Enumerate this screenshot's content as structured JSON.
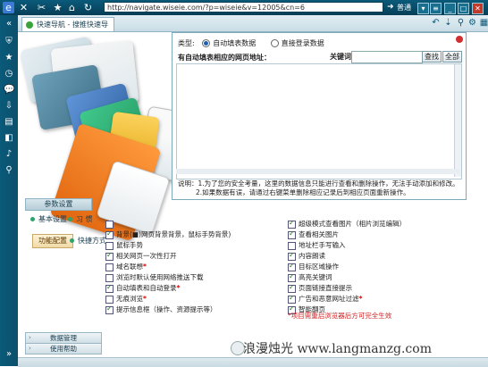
{
  "topbar": {
    "url": "http://navigate.wiseie.com/?p=wiseie&v=12005&cn=6",
    "mode_label": "普通",
    "go_icon": "arrow-right-icon"
  },
  "tab": {
    "label": "快速导航 - 搜推快速导航"
  },
  "dialog": {
    "type_label": "类型:",
    "radio_auto": "自动填表数据",
    "radio_login": "直接登录数据",
    "list_heading": "有自动填表相应的网页地址：",
    "keyword_label": "关键词:",
    "keyword_value": "",
    "search_button": "查找",
    "all_button": "全部",
    "note_line1": "说明：1.为了您的安全考量，这里的数据信息只能进行查看和删除操作，无法手动添加和修改。",
    "note_line2": "2.如果数据有误，请通过右键菜单删除相应记录后到相应页面重新操作。"
  },
  "settings": {
    "header": "参数设置",
    "categories": [
      {
        "label": "基本设置"
      },
      {
        "label": "习 惯"
      }
    ],
    "side_button": "功能配置",
    "side_label": "快捷方式",
    "bottom_buttons": [
      "数据管理",
      "使用帮助"
    ],
    "left_options": [
      {
        "label": "",
        "checked": false
      },
      {
        "label": "背景(■)网页背景背景，鼠标手势背景)",
        "checked": true
      },
      {
        "label": "鼠标手势",
        "checked": false
      },
      {
        "label": "相关网页一次性打开",
        "checked": true
      },
      {
        "label": "域名联想",
        "checked": false,
        "flag": true
      },
      {
        "label": "浏览时默认使用网络推送下载",
        "checked": false
      },
      {
        "label": "自动填表和自动登录",
        "checked": true,
        "flag": true
      },
      {
        "label": "无痕浏览",
        "checked": false,
        "flag": true
      },
      {
        "label": "提示信息框（操作、资源提示等）",
        "checked": true
      }
    ],
    "right_options": [
      {
        "label": "超级模式查看图片（相片浏览编辑）",
        "checked": true
      },
      {
        "label": "查看相关图片",
        "checked": true
      },
      {
        "label": "地址栏手写输入",
        "checked": false
      },
      {
        "label": "内容朗读",
        "checked": true
      },
      {
        "label": "目标区域操作",
        "checked": true
      },
      {
        "label": "高亮关键词",
        "checked": true
      },
      {
        "label": "页面链接直接提示",
        "checked": true
      },
      {
        "label": "广告和恶意网址过滤",
        "checked": true,
        "flag": true
      },
      {
        "label": "智能翻页",
        "checked": true
      }
    ],
    "warning": "*项目需重启浏览器后方可完全生效"
  },
  "watermark": "浪漫烛光 www.langmanzg.com",
  "colors": {
    "titlebar": "#0b5a7a",
    "accent_green": "#2ea36a",
    "warning_red": "#d02020"
  }
}
